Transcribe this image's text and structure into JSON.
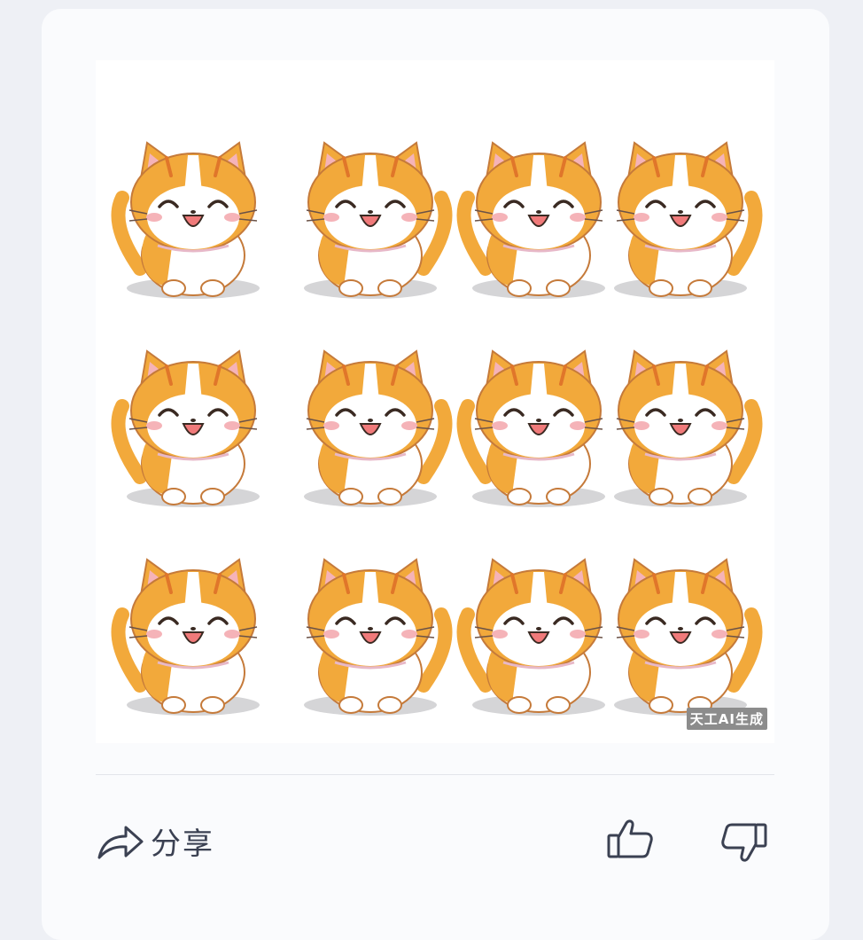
{
  "image": {
    "description_icon": "cat-sticker-sheet-image",
    "watermark": "天工AI生成",
    "accent_colors": {
      "orange": "#f2a93b",
      "dark_orange": "#e0762a",
      "blush": "#f5b3b8",
      "tongue": "#f07a7a"
    }
  },
  "actions": {
    "share_label": "分享",
    "share_icon": "share-arrow-icon",
    "like_icon": "thumbs-up-icon",
    "dislike_icon": "thumbs-down-icon"
  },
  "colors": {
    "card_bg": "#fafbfd",
    "page_bg": "#eef0f5",
    "icon_stroke": "#3b4152"
  }
}
